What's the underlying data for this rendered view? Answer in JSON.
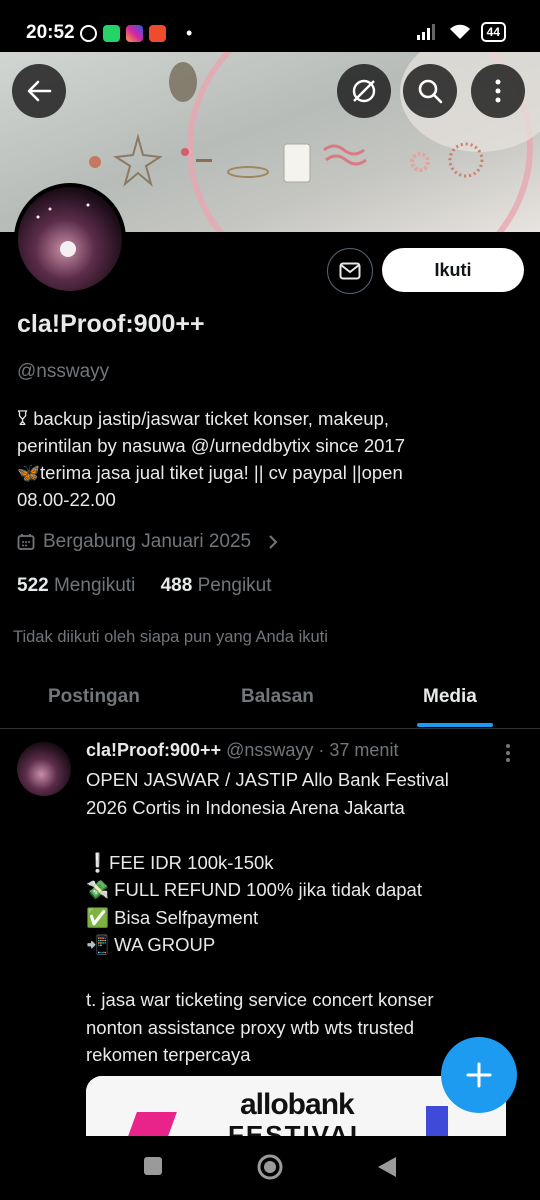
{
  "status_bar": {
    "time": "20:52",
    "battery": "44"
  },
  "profile": {
    "display_name": "cla!Proof:900++",
    "handle": "@nsswayy",
    "bio": "𐃯 backup jastip/jaswar ticket konser, makeup,\nperintilan by nasuwa @/urneddbytix since 2017\n🦋terima jasa jual tiket juga! || cv paypal ||open\n08.00-22.00",
    "joined": "Bergabung Januari 2025",
    "following_count": "522",
    "following_label": "Mengikuti",
    "followers_count": "488",
    "followers_label": "Pengikut",
    "followed_by_note": "Tidak diikuti oleh siapa pun yang Anda ikuti",
    "follow_button": "Ikuti"
  },
  "tabs": [
    {
      "label": "Postingan",
      "active": false
    },
    {
      "label": "Balasan",
      "active": false
    },
    {
      "label": "Media",
      "active": true
    }
  ],
  "tweet": {
    "name": "cla!Proof:900++",
    "handle": "@nsswayy",
    "time": "37 menit",
    "text": "OPEN JASWAR / JASTIP Allo Bank Festival\n2026 Cortis in Indonesia Arena Jakarta\n\n❕FEE IDR 100k-150k\n💸 FULL REFUND 100% jika tidak dapat\n✅ Bisa Selfpayment\n📲 WA GROUP\n\nt. jasa war ticketing service concert konser\nnonton assistance proxy wtb wts trusted\nrekomen terpercaya",
    "media_logo": "allobank",
    "media_subtext": "FESTIVAL"
  },
  "icons": [
    "back-arrow-icon",
    "grok-icon",
    "search-icon",
    "more-vertical-icon",
    "mail-icon",
    "calendar-icon",
    "chevron-right-icon",
    "plus-icon",
    "recents-icon",
    "home-icon",
    "back-icon"
  ],
  "colors": {
    "accent": "#1d9bf0",
    "background": "#000000",
    "muted": "#71767b"
  }
}
